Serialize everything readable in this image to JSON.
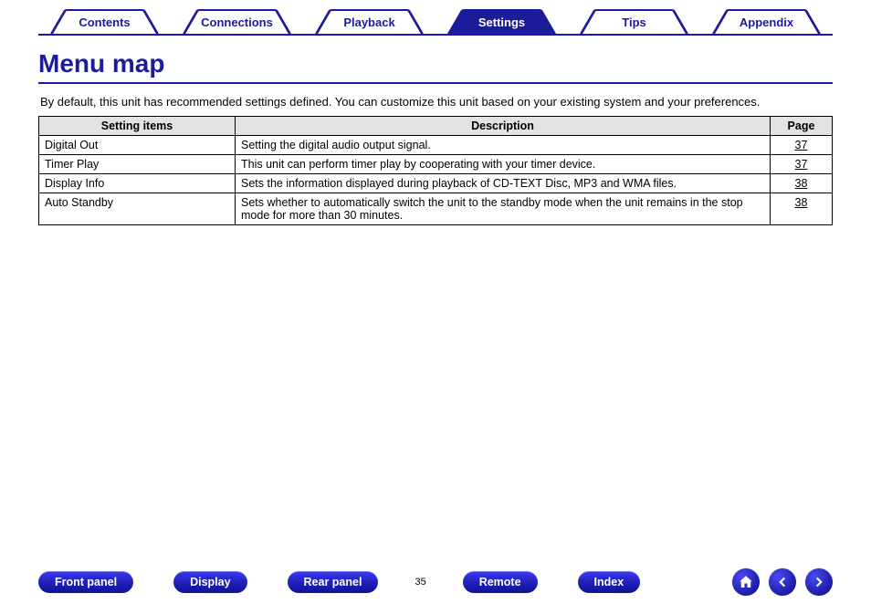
{
  "tabs": [
    {
      "label": "Contents",
      "active": false
    },
    {
      "label": "Connections",
      "active": false
    },
    {
      "label": "Playback",
      "active": false
    },
    {
      "label": "Settings",
      "active": true
    },
    {
      "label": "Tips",
      "active": false
    },
    {
      "label": "Appendix",
      "active": false
    }
  ],
  "title": "Menu map",
  "intro": "By default, this unit has recommended settings defined. You can customize this unit based on your existing system and your preferences.",
  "table": {
    "headers": {
      "item": "Setting items",
      "desc": "Description",
      "page": "Page"
    },
    "rows": [
      {
        "item": "Digital Out",
        "desc": "Setting the digital audio output signal.",
        "page": "37"
      },
      {
        "item": "Timer Play",
        "desc": "This unit can perform timer play by cooperating with your timer device.",
        "page": "37"
      },
      {
        "item": "Display Info",
        "desc": "Sets the information displayed during playback of CD-TEXT Disc, MP3 and WMA files.",
        "page": "38"
      },
      {
        "item": "Auto Standby",
        "desc": "Sets whether to automatically switch the unit to the standby mode when the unit remains in the stop mode for more than 30 minutes.",
        "page": "38"
      }
    ]
  },
  "footer": {
    "buttons": [
      "Front panel",
      "Display",
      "Rear panel"
    ],
    "page_number": "35",
    "buttons2": [
      "Remote",
      "Index"
    ]
  }
}
